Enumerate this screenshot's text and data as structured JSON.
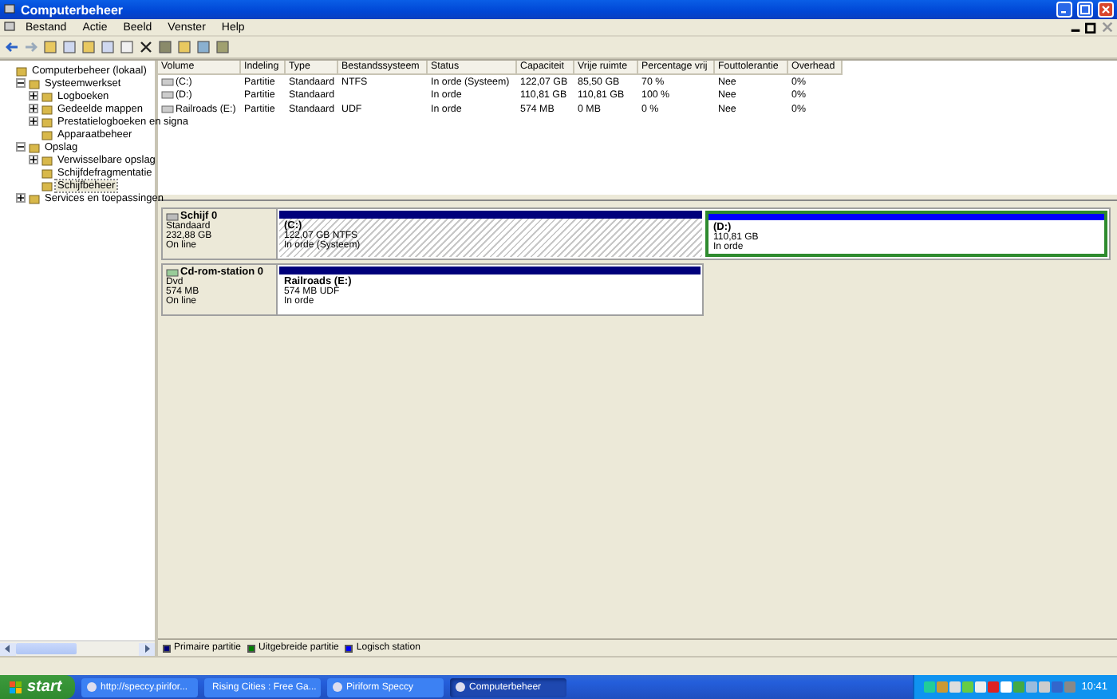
{
  "window": {
    "title": "Computerbeheer"
  },
  "menu": [
    "Bestand",
    "Actie",
    "Beeld",
    "Venster",
    "Help"
  ],
  "tree": [
    {
      "label": "Computerbeheer (lokaal)",
      "selected": false,
      "children": [
        {
          "label": "Systeemwerkset",
          "expanded": true,
          "selected": false,
          "children": [
            {
              "label": "Logboeken",
              "expanded": false,
              "selected": false
            },
            {
              "label": "Gedeelde mappen",
              "expanded": false,
              "selected": false
            },
            {
              "label": "Prestatielogboeken en signa",
              "expanded": false,
              "selected": false
            },
            {
              "label": "Apparaatbeheer",
              "selected": false
            }
          ]
        },
        {
          "label": "Opslag",
          "expanded": true,
          "selected": false,
          "children": [
            {
              "label": "Verwisselbare opslag",
              "expanded": false,
              "selected": false
            },
            {
              "label": "Schijfdefragmentatie",
              "selected": false
            },
            {
              "label": "Schijfbeheer",
              "selected": true
            }
          ]
        },
        {
          "label": "Services en toepassingen",
          "expanded": false,
          "selected": false
        }
      ]
    }
  ],
  "table": {
    "columns": [
      "Volume",
      "Indeling",
      "Type",
      "Bestandssysteem",
      "Status",
      "Capaciteit",
      "Vrije ruimte",
      "Percentage vrij",
      "Fouttolerantie",
      "Overhead"
    ],
    "rows": [
      [
        "(C:)",
        "Partitie",
        "Standaard",
        "NTFS",
        "In orde (Systeem)",
        "122,07 GB",
        "85,50 GB",
        "70 %",
        "Nee",
        "0%"
      ],
      [
        "(D:)",
        "Partitie",
        "Standaard",
        "",
        "In orde",
        "110,81 GB",
        "110,81 GB",
        "100 %",
        "Nee",
        "0%"
      ],
      [
        "Railroads (E:)",
        "Partitie",
        "Standaard",
        "UDF",
        "In orde",
        "574 MB",
        "0 MB",
        "0 %",
        "Nee",
        "0%"
      ]
    ]
  },
  "disks": [
    {
      "kind": "harddisk",
      "name": "Schijf 0",
      "type": "Standaard",
      "size": "232,88 GB",
      "state": "On line",
      "partitions": [
        {
          "kind": "primary",
          "name": "(C:)",
          "size": "122,07 GB NTFS",
          "status": "In orde (Systeem)",
          "selected": true,
          "extended": false
        },
        {
          "kind": "logical",
          "name": "(D:)",
          "size": "110,81 GB",
          "status": "In orde",
          "selected": false,
          "extended": true
        }
      ]
    },
    {
      "kind": "cdrom",
      "name": "Cd-rom-station 0",
      "type": "Dvd",
      "size": "574 MB",
      "state": "On line",
      "partitions": [
        {
          "kind": "primary",
          "name": "Railroads  (E:)",
          "size": "574 MB UDF",
          "status": "In orde",
          "selected": false,
          "extended": false
        }
      ]
    }
  ],
  "legend": [
    {
      "label": "Primaire partitie",
      "color": "#00007b"
    },
    {
      "label": "Uitgebreide partitie",
      "color": "#008000"
    },
    {
      "label": "Logisch station",
      "color": "#0000ff"
    }
  ],
  "taskbar": {
    "start": "start",
    "tasks": [
      {
        "label": "http://speccy.pirifor...",
        "selected": false
      },
      {
        "label": "Rising Cities : Free Ga...",
        "selected": false
      },
      {
        "label": "Piriform Speccy",
        "selected": false
      },
      {
        "label": "Computerbeheer",
        "selected": true
      }
    ],
    "clock": "10:41"
  }
}
